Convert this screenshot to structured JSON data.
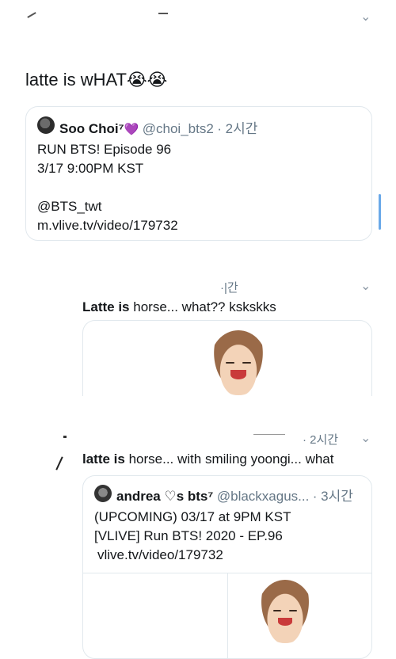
{
  "tweet1": {
    "text": "latte is wHAT",
    "emoji": "😭😭",
    "quote": {
      "name": "Soo Choi⁷",
      "heart": "💜",
      "handle": "@choi_bts2",
      "time": "· 2시간",
      "lines": [
        "RUN BTS! Episode 96",
        "3/17 9:00PM KST",
        "",
        "@BTS_twt",
        "m.vlive.tv/video/179732"
      ]
    }
  },
  "tweet2": {
    "time": "·|간",
    "text_bold": "Latte is",
    "text_rest": " horse... what?? kskskks"
  },
  "tweet3": {
    "time": "· 2시간",
    "text_bold": "latte is",
    "text_rest": " horse... with smiling yoongi... what",
    "quote": {
      "name": "andrea ♡s bts⁷",
      "handle": "@blackxagus...",
      "time": "· 3시간",
      "lines": [
        "(UPCOMING) 03/17 at 9PM KST",
        "[VLIVE] Run BTS! 2020 - EP.96",
        "vlive.tv/video/179732"
      ]
    }
  },
  "icons": {
    "chevron": "chevron-down-icon"
  }
}
